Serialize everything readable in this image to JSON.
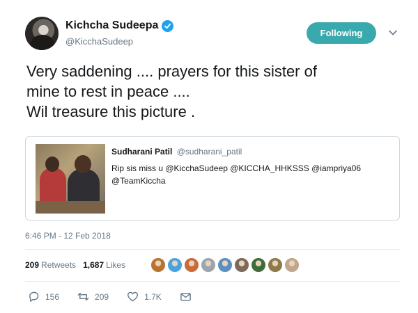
{
  "author": {
    "display_name": "Kichcha Sudeepa",
    "handle": "@KicchaSudeep",
    "verified": true
  },
  "follow_button": {
    "label": "Following",
    "color": "#3aa9ad"
  },
  "tweet": {
    "text": "Very saddening ....  prayers for this sister of\nmine to rest in peace ....\nWil treasure this picture ."
  },
  "quoted_tweet": {
    "name": "Sudharani Patil",
    "handle": "@sudharani_patil",
    "text": "Rip sis miss u @KicchaSudeep @KICCHA_HHKSSS @iampriya06 @TeamKiccha"
  },
  "timestamp": "6:46 PM - 12 Feb 2018",
  "stats": {
    "retweets_count": "209",
    "retweets_label": "Retweets",
    "likes_count": "1,687",
    "likes_label": "Likes"
  },
  "likers": [
    "#b8732e",
    "#4aa3e0",
    "#c96b3a",
    "#9aa5ad",
    "#5a8fbf",
    "#7d6a5a",
    "#3f6d3a",
    "#8c7a4a",
    "#c2a58a"
  ],
  "actions": {
    "replies": "156",
    "retweets": "209",
    "likes": "1.7K"
  },
  "colors": {
    "accent": "#1da1f2",
    "muted": "#657786"
  }
}
